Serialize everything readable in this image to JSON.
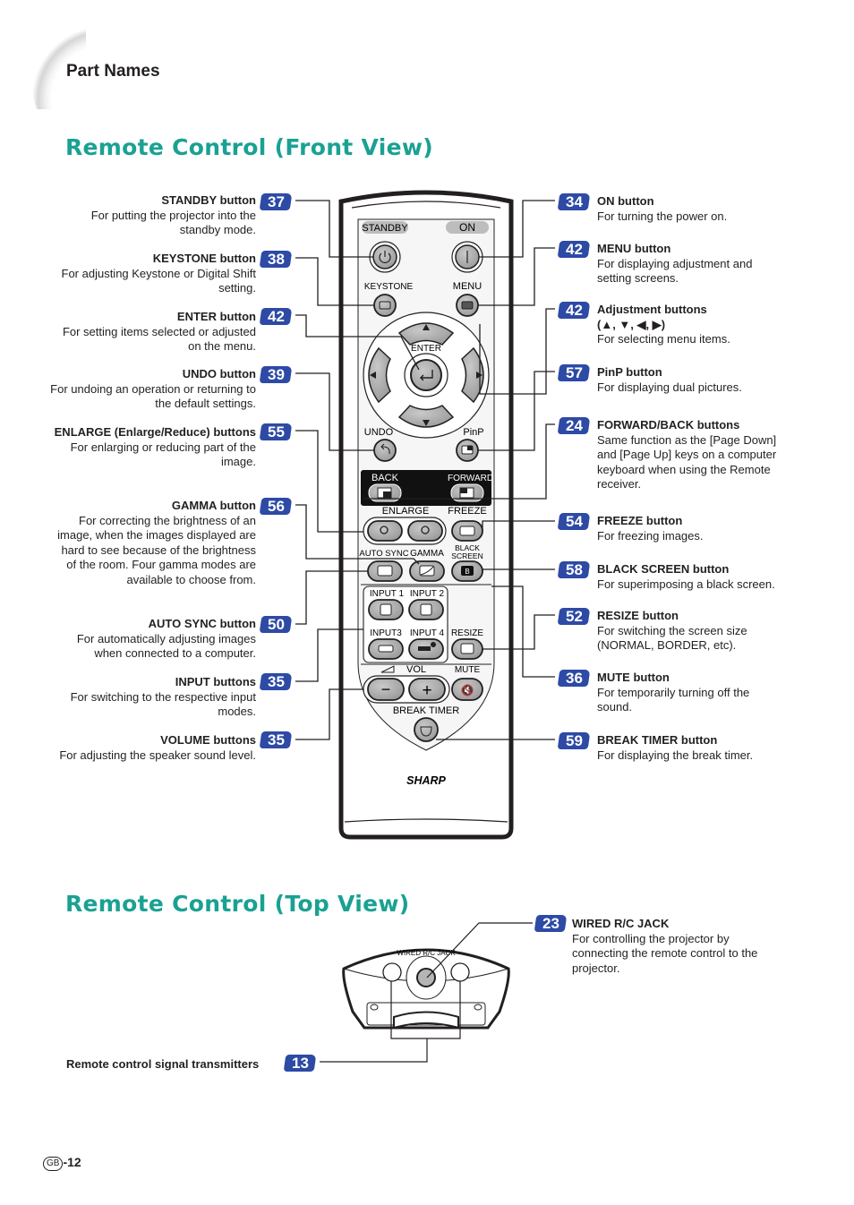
{
  "header": {
    "section_label": "Part Names",
    "front_title": "Remote Control (Front View)",
    "top_title": "Remote Control (Top View)"
  },
  "colors": {
    "title_teal": "#1aa193",
    "badge_blue": "#2d4aa5"
  },
  "left_callouts": [
    {
      "title": "STANDBY button",
      "page": "37",
      "desc": "For putting the projector into the standby mode."
    },
    {
      "title": "KEYSTONE button",
      "page": "38",
      "desc": "For adjusting Keystone or Digital Shift setting."
    },
    {
      "title": "ENTER button",
      "page": "42",
      "desc": "For setting items selected or adjusted on the menu."
    },
    {
      "title": "UNDO button",
      "page": "39",
      "desc": "For undoing an operation or returning to the default settings."
    },
    {
      "title": "ENLARGE (Enlarge/Reduce) buttons",
      "page": "55",
      "desc": "For enlarging or reducing part of the image."
    },
    {
      "title": "GAMMA button",
      "page": "56",
      "desc": "For correcting the brightness of an image, when the images displayed are hard to see because of the brightness of the room. Four gamma modes are available to choose from."
    },
    {
      "title": "AUTO SYNC button",
      "page": "50",
      "desc": "For automatically adjusting images when connected to a computer."
    },
    {
      "title": "INPUT buttons",
      "page": "35",
      "desc": "For switching to the respective input modes."
    },
    {
      "title": "VOLUME buttons",
      "page": "35",
      "desc": "For adjusting the speaker sound level."
    }
  ],
  "right_callouts": [
    {
      "title": "ON button",
      "page": "34",
      "desc": "For turning the power on."
    },
    {
      "title": "MENU button",
      "page": "42",
      "desc": "For displaying adjustment and setting screens."
    },
    {
      "title": "Adjustment buttons",
      "title2": "(▲, ▼, ◀, ▶)",
      "page": "42",
      "desc": "For selecting menu items."
    },
    {
      "title": "PinP button",
      "page": "57",
      "desc": "For displaying dual pictures."
    },
    {
      "title": "FORWARD/BACK buttons",
      "page": "24",
      "desc": "Same function as the [Page Down] and [Page Up] keys on a computer keyboard when using the Remote receiver."
    },
    {
      "title": "FREEZE button",
      "page": "54",
      "desc": "For freezing images."
    },
    {
      "title": "BLACK SCREEN button",
      "page": "58",
      "desc": "For superimposing a black screen."
    },
    {
      "title": "RESIZE button",
      "page": "52",
      "desc": "For switching the screen size (NORMAL, BORDER, etc)."
    },
    {
      "title": "MUTE button",
      "page": "36",
      "desc": "For temporarily turning off the sound."
    },
    {
      "title": "BREAK TIMER button",
      "page": "59",
      "desc": "For displaying the break timer."
    }
  ],
  "remote_labels": {
    "standby": "STANDBY",
    "on": "ON",
    "keystone": "KEYSTONE",
    "menu": "MENU",
    "enter": "ENTER",
    "undo": "UNDO",
    "pinp": "PinP",
    "back": "BACK",
    "forward": "FORWARD",
    "enlarge": "ENLARGE",
    "freeze": "FREEZE",
    "auto_sync": "AUTO SYNC",
    "gamma": "GAMMA",
    "black": "BLACK",
    "screen": "SCREEN",
    "input1": "INPUT 1",
    "input2": "INPUT 2",
    "input3": "INPUT3",
    "input4": "INPUT 4",
    "resize": "RESIZE",
    "vol": "VOL",
    "mute": "MUTE",
    "break_timer": "BREAK TIMER",
    "brand": "SHARP",
    "black_btn": "B",
    "minus": "−",
    "plus": "+",
    "power_on": "|"
  },
  "top_view": {
    "jack_label": "WIRED R/C JACK",
    "jack_callout": {
      "title": "WIRED R/C JACK",
      "page": "23",
      "desc": "For controlling the projector by connecting the remote control to the projector."
    },
    "transmitter_callout": {
      "title": "Remote control signal transmitters",
      "page": "13"
    }
  },
  "footer": {
    "region": "GB",
    "page": "-12"
  }
}
